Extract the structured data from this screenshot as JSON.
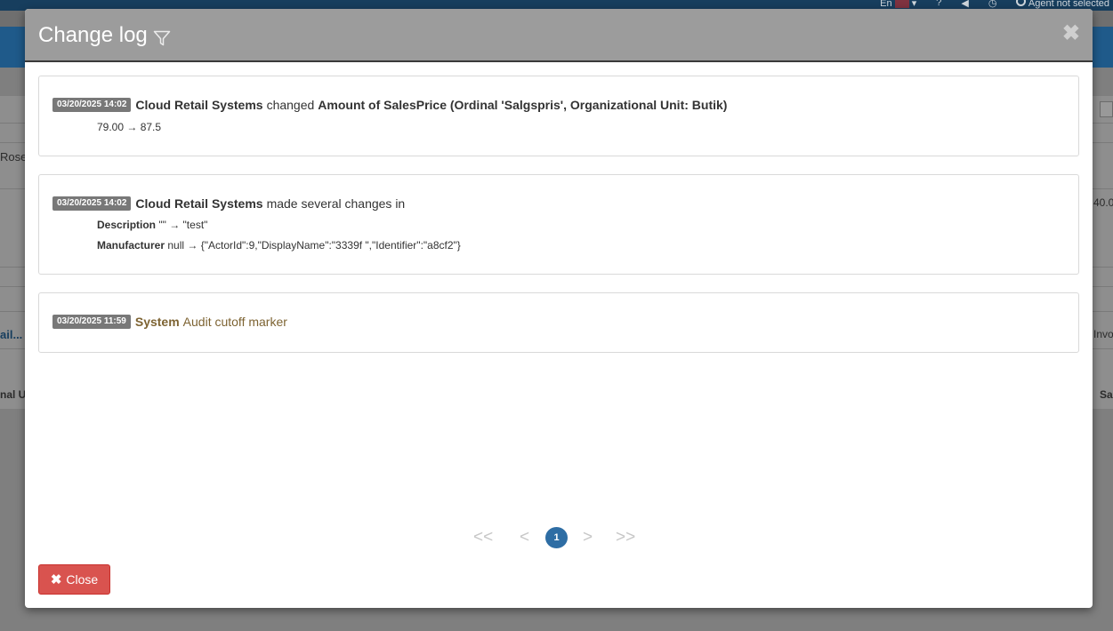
{
  "background": {
    "topbar": {
      "language": "En",
      "agent_status": "Agent not selected"
    },
    "fragments": {
      "left_name": "Rose",
      "left_link": "ail...",
      "left_column": "nal U",
      "right_value": "40.0",
      "right_link": "Invo",
      "right_column": "Sa"
    }
  },
  "modal": {
    "title": "Change log",
    "entries": [
      {
        "timestamp": "03/20/2025 14:02",
        "actor": "Cloud Retail Systems",
        "verb": "changed",
        "target": "Amount of SalesPrice (Ordinal 'Salgspris', Organizational Unit: Butik)",
        "change": "79.00 → 87.5"
      },
      {
        "timestamp": "03/20/2025 14:02",
        "actor": "Cloud Retail Systems",
        "verb": "made several changes in",
        "fields": [
          {
            "label": "Description",
            "change": "\"\" → \"test\""
          },
          {
            "label": "Manufacturer",
            "change": "null → {\"ActorId\":9,\"DisplayName\":\"3339f \",\"Identifier\":\"a8cf2\"}"
          }
        ]
      },
      {
        "timestamp": "03/20/2025 11:59",
        "actor": "System",
        "message": "Audit cutoff marker"
      }
    ],
    "pagination": {
      "first": "<<",
      "prev": "<",
      "current": "1",
      "next": ">",
      "last": ">>"
    },
    "close_button": "Close"
  }
}
